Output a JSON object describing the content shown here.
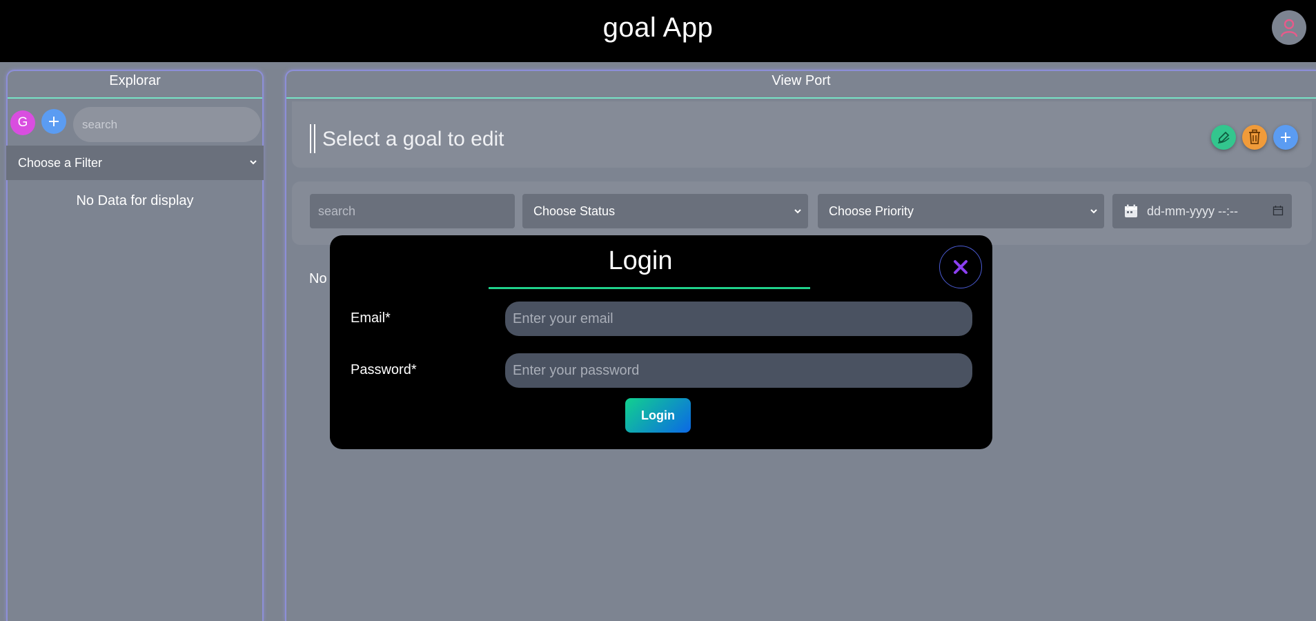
{
  "header": {
    "title": "goal App"
  },
  "explorer": {
    "title": "Explorar",
    "group_initial": "G",
    "search_placeholder": "search",
    "filter_label": "Choose a Filter",
    "empty_text": "No Data for display"
  },
  "viewport": {
    "title": "View Port",
    "goal_placeholder": "Select a goal to edit",
    "filters": {
      "search_placeholder": "search",
      "status_label": "Choose Status",
      "priority_label": "Choose Priority",
      "date_placeholder": "dd-mm-yyyy --:--"
    },
    "partial_text": "No"
  },
  "login_modal": {
    "title": "Login",
    "email_label": "Email*",
    "email_placeholder": "Enter your email",
    "password_label": "Password*",
    "password_placeholder": "Enter your password",
    "submit_label": "Login"
  },
  "colors": {
    "accent_green": "#1fd18b",
    "edit": "#33c68e",
    "delete": "#f09b3a",
    "add": "#5b9cf2",
    "avatar_badge": "#d94ee0"
  }
}
